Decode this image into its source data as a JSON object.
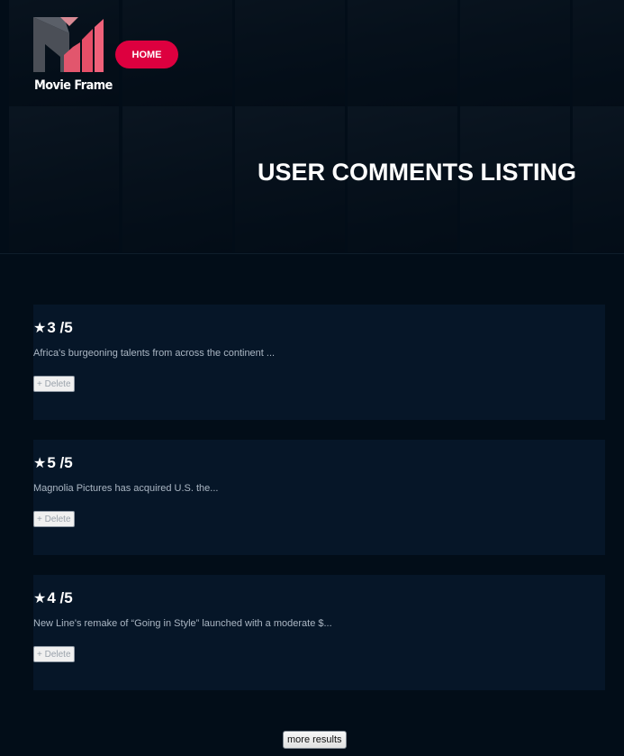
{
  "header": {
    "logo_text": "Movie Frame",
    "home_label": "HOME"
  },
  "hero": {
    "title": "USER COMMENTS LISTING"
  },
  "comments": [
    {
      "rating": "3",
      "rating_suffix": " /5",
      "text": "Africa's burgeoning talents from across the continent ...",
      "delete_label": "+ Delete"
    },
    {
      "rating": "5",
      "rating_suffix": " /5",
      "text": "Magnolia Pictures has acquired U.S. the...",
      "delete_label": "+ Delete"
    },
    {
      "rating": "4",
      "rating_suffix": " /5",
      "text": "New Line's remake of “Going in Style” launched with a moderate $...",
      "delete_label": "+ Delete"
    }
  ],
  "pagination": {
    "more_label": "more results"
  },
  "icons": {
    "star": "star-icon"
  },
  "colors": {
    "accent": "#dd003f",
    "background": "#020d18",
    "card": "#061628",
    "muted_text": "#abb7c4"
  }
}
